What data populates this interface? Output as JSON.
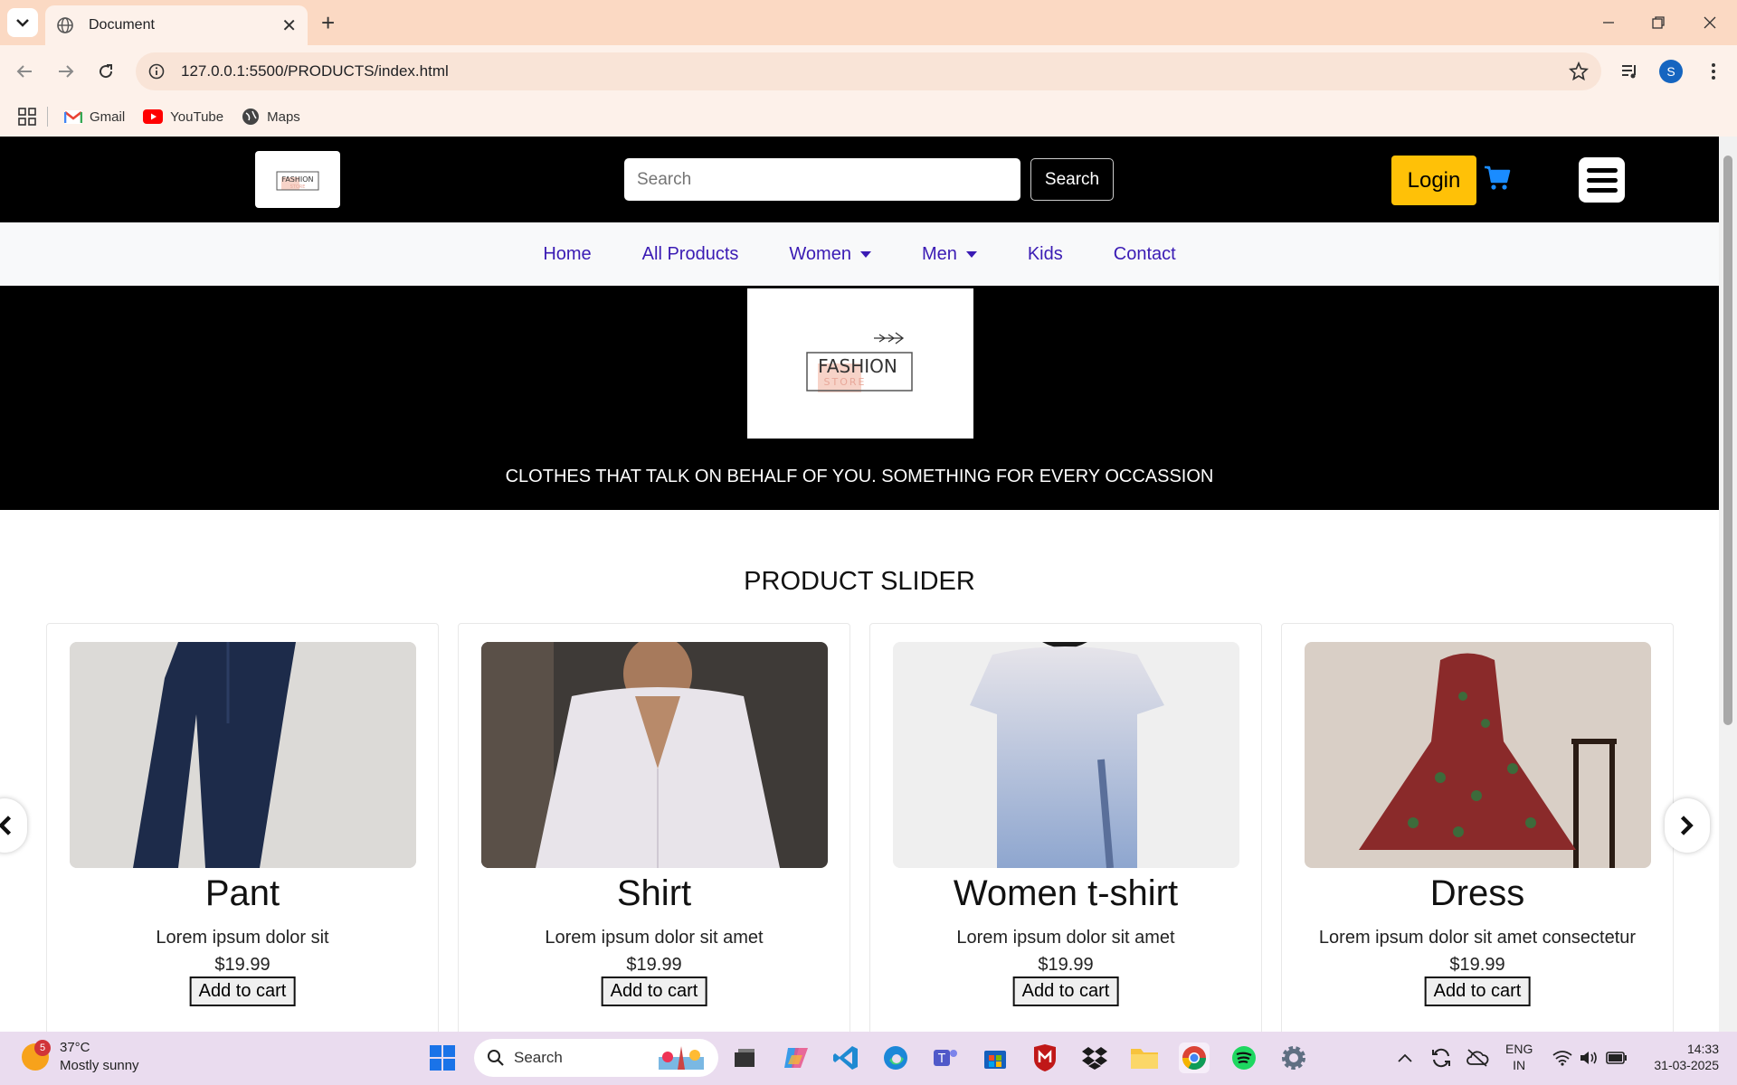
{
  "browser": {
    "tab_title": "Document",
    "url": "127.0.0.1:5500/PRODUCTS/index.html",
    "profile_initial": "S",
    "bookmarks": [
      {
        "label": "Gmail",
        "icon": "gmail-icon"
      },
      {
        "label": "YouTube",
        "icon": "youtube-icon"
      },
      {
        "label": "Maps",
        "icon": "maps-icon"
      }
    ]
  },
  "header": {
    "search_placeholder": "Search",
    "search_button": "Search",
    "login_button": "Login",
    "brand_accent": "#ffc107"
  },
  "nav": {
    "items": [
      {
        "label": "Home",
        "dropdown": false
      },
      {
        "label": "All Products",
        "dropdown": false
      },
      {
        "label": "Women",
        "dropdown": true
      },
      {
        "label": "Men",
        "dropdown": true
      },
      {
        "label": "Kids",
        "dropdown": false
      },
      {
        "label": "Contact",
        "dropdown": false
      }
    ],
    "link_color": "#3a1bb4"
  },
  "hero": {
    "logo_text": "FASHION",
    "logo_subtext": "STORE",
    "tagline": "CLOTHES THAT TALK ON BEHALF OF YOU. SOMETHING FOR EVERY OCCASSION"
  },
  "slider": {
    "title": "PRODUCT SLIDER",
    "products": [
      {
        "name": "Pant",
        "desc": "Lorem ipsum dolor sit",
        "price": "$19.99",
        "button": "Add to cart"
      },
      {
        "name": "Shirt",
        "desc": "Lorem ipsum dolor sit amet",
        "price": "$19.99",
        "button": "Add to cart"
      },
      {
        "name": "Women t-shirt",
        "desc": "Lorem ipsum dolor sit amet",
        "price": "$19.99",
        "button": "Add to cart"
      },
      {
        "name": "Dress",
        "desc": "Lorem ipsum dolor sit amet consectetur",
        "price": "$19.99",
        "button": "Add to cart"
      }
    ]
  },
  "taskbar": {
    "weather_temp": "37°C",
    "weather_desc": "Mostly sunny",
    "weather_badge": "5",
    "search_label": "Search",
    "lang_1": "ENG",
    "lang_2": "IN",
    "time": "14:33",
    "date": "31-03-2025"
  }
}
